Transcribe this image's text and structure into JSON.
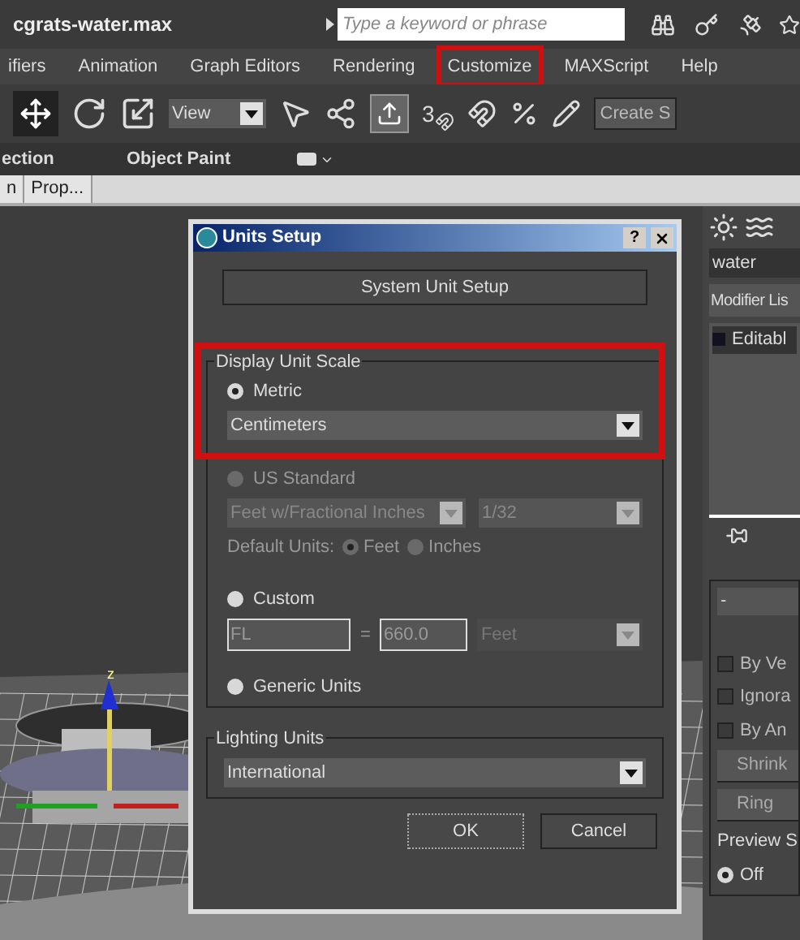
{
  "title_bar": {
    "filename": "cgrats-water.max",
    "search": {
      "placeholder": "Type a keyword or phrase"
    }
  },
  "menu": [
    {
      "label": "ifiers",
      "highlighted": false
    },
    {
      "label": "Animation",
      "highlighted": false
    },
    {
      "label": "Graph Editors",
      "highlighted": false
    },
    {
      "label": "Rendering",
      "highlighted": false
    },
    {
      "label": "Customize",
      "highlighted": true
    },
    {
      "label": "MAXScript",
      "highlighted": false
    },
    {
      "label": "Help",
      "highlighted": false
    }
  ],
  "toolbar": {
    "view_dropdown": "View",
    "snap_label": "3",
    "named_selection": "Create S"
  },
  "ribbon": [
    "ection",
    "Object Paint"
  ],
  "tabs": [
    {
      "label": "n",
      "selected": false
    },
    {
      "label": "Prop...",
      "selected": false
    }
  ],
  "viewport": {
    "axis_label": "z"
  },
  "dialog": {
    "title": "Units Setup",
    "help_button": "?",
    "system_button": "System Unit Setup",
    "display_unit_scale": {
      "label": "Display Unit Scale",
      "options": [
        {
          "kind": "metric",
          "label": "Metric",
          "selected": true,
          "disabled": false,
          "dropdown": "Centimeters"
        },
        {
          "kind": "us",
          "label": "US Standard",
          "selected": false,
          "disabled": true,
          "dropdown": "Feet w/Fractional Inches",
          "fraction": "1/32",
          "default_units_label": "Default Units:",
          "default_units": [
            {
              "label": "Feet",
              "selected": true
            },
            {
              "label": "Inches",
              "selected": false
            }
          ]
        },
        {
          "kind": "custom",
          "label": "Custom",
          "selected": false,
          "disabled": false,
          "name_value": "FL",
          "equals": "=",
          "amount": "660.0",
          "unit": "Feet"
        },
        {
          "kind": "generic",
          "label": "Generic Units",
          "selected": false,
          "disabled": false
        }
      ]
    },
    "lighting": {
      "label": "Lighting Units",
      "value": "International"
    },
    "buttons": [
      "OK",
      "Cancel"
    ]
  },
  "command_panel": {
    "object_name": "water",
    "modifier_list": "Modifier Lis",
    "stack": [
      "Editabl"
    ],
    "rollout": "-",
    "checkboxes": [
      {
        "label": "By Ve",
        "checked": false
      },
      {
        "label": "Ignora",
        "checked": false
      },
      {
        "label": "By An",
        "checked": false
      }
    ],
    "buttons": [
      "Shrink",
      "Ring"
    ],
    "preview_group": "Preview S",
    "preview_options": [
      {
        "label": "Off",
        "selected": true
      }
    ]
  }
}
